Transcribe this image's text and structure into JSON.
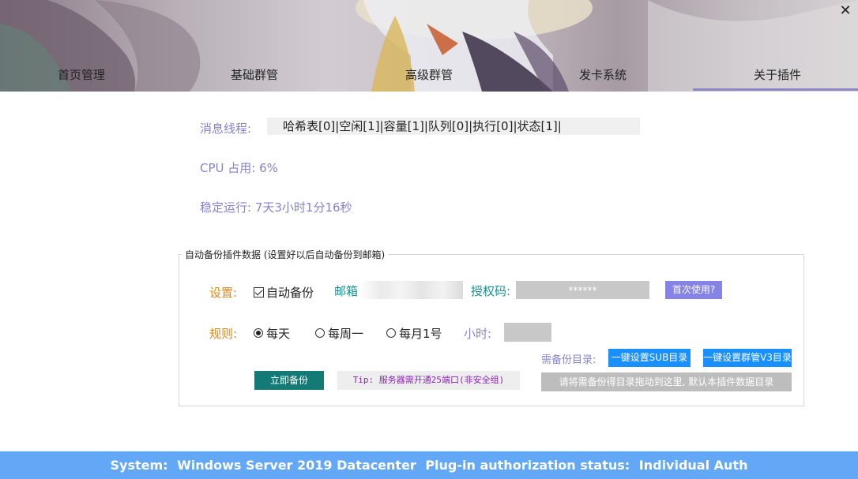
{
  "window": {
    "close_glyph": "✕"
  },
  "tabs": [
    {
      "label": "首页管理"
    },
    {
      "label": "基础群管"
    },
    {
      "label": "高级群管"
    },
    {
      "label": "发卡系统"
    },
    {
      "label": "关于插件",
      "active": true
    }
  ],
  "status": {
    "thread_label": "消息线程:",
    "thread_value": "哈希表[0]|空闲[1]|容量[1]|队列[0]|执行[0]|状态[1]|",
    "cpu_text": "CPU 占用: 6%",
    "uptime_text": "稳定运行: 7天3小时1分16秒"
  },
  "backup": {
    "legend": "自动备份插件数据 (设置好以后自动备份到邮箱)",
    "settings_label": "设置:",
    "auto_backup_label": "自动备份",
    "auto_backup_checked": true,
    "email_label": "邮箱",
    "email_value": "",
    "auth_label": "授权码:",
    "auth_value": "******",
    "first_use_label": "首次使用?",
    "rule_label": "规则:",
    "rules": [
      {
        "label": "每天",
        "checked": true
      },
      {
        "label": "每周一",
        "checked": false
      },
      {
        "label": "每月1号",
        "checked": false
      }
    ],
    "hour_label": "小时:",
    "hour_value": "",
    "dir_label": "需备份目录:",
    "sub_dir_button": "一键设置SUB目录",
    "v3_dir_button": "一键设置群管V3目录",
    "backup_now_button": "立即备份",
    "tip": "Tip: 服务器需开通25端口(非安全组)",
    "drop_zone_text": "请将需备份得目录拖动到这里, 默认本插件数据目录"
  },
  "footer": {
    "system_label": "System:",
    "system_value": "Windows Server 2019 Datacenter",
    "auth_status_label": "Plug-in authorization status:",
    "auth_status_value": "Individual Auth"
  },
  "colors": {
    "accent_purple": "#8583cc",
    "orange": "#d88a1c",
    "teal": "#159191",
    "blue_button": "#1890ff",
    "footer_bg": "#62a8f7",
    "dark_teal_button": "#137a76",
    "tip_text": "#8b23b5"
  },
  "icons": {
    "close": "close-icon",
    "checkbox": "checkbox-checked-icon",
    "radio": "radio-icon"
  }
}
